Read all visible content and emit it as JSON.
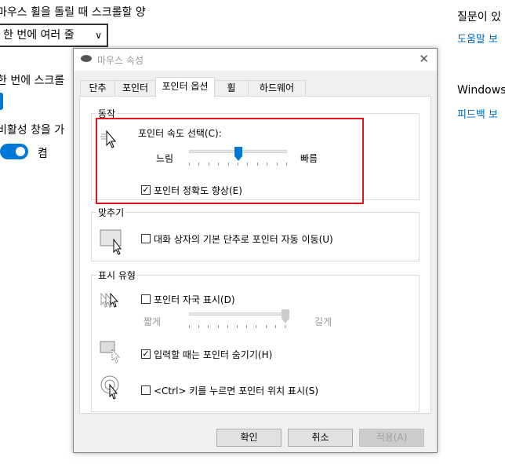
{
  "background": {
    "scroll_text": "마우스 휠을 돌릴 때 스크롤할 양",
    "scroll_select_value": "한 번에 여러 줄",
    "lines_label": "한 번에 스크롤",
    "inactive_label": "비활성 창을 가",
    "toggle_state": "켬",
    "question_text": "질문이 있",
    "help_link": "도움말 보",
    "windows_text": "Windows",
    "feedback_link": "피드백 보"
  },
  "dialog": {
    "title": "마우스 속성",
    "tabs": [
      "단추",
      "포인터",
      "포인터 옵션",
      "휠",
      "하드웨어"
    ],
    "active_tab": "포인터 옵션",
    "motion": {
      "group": "동작",
      "speed_label": "포인터 속도 선택(C):",
      "slow": "느림",
      "fast": "빠름",
      "speed_fraction": 0.5,
      "precision_label": "포인터 정확도 향상(E)",
      "precision_checked": true
    },
    "snap": {
      "group": "맞추기",
      "label": "대화 상자의 기본 단추로 포인터 자동 이동(U)",
      "checked": false
    },
    "visibility": {
      "group": "표시 유형",
      "trails_label": "포인터 자국 표시(D)",
      "trails_checked": false,
      "short": "짧게",
      "long": "길게",
      "trails_fraction": 1.0,
      "hide_label": "입력할 때는 포인터 숨기기(H)",
      "hide_checked": true,
      "ctrl_label": "<Ctrl> 키를 누르면 포인터 위치 표시(S)",
      "ctrl_checked": false
    },
    "buttons": {
      "ok": "확인",
      "cancel": "취소",
      "apply": "적용(A)"
    }
  },
  "colors": {
    "accent": "#0078d7",
    "highlight": "#e0161f",
    "link": "#0067b8"
  }
}
